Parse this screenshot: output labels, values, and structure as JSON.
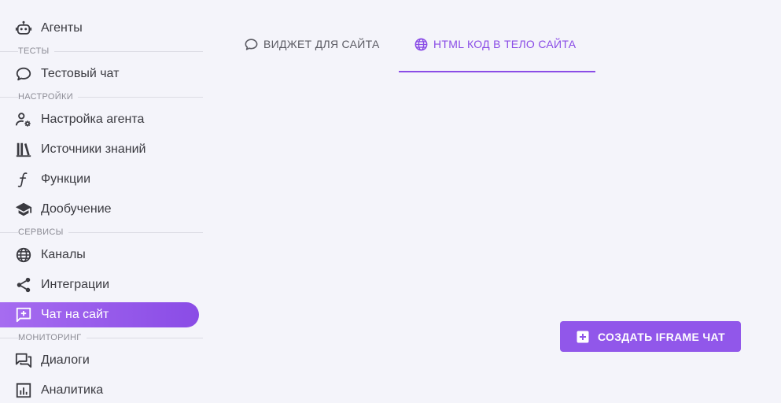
{
  "sidebar": {
    "items": [
      {
        "label": "Агенты"
      },
      {
        "label": "Тестовый чат"
      },
      {
        "label": "Настройка агента"
      },
      {
        "label": "Источники знаний"
      },
      {
        "label": "Функции"
      },
      {
        "label": "Дообучение"
      },
      {
        "label": "Каналы"
      },
      {
        "label": "Интеграции"
      },
      {
        "label": "Чат на сайт"
      },
      {
        "label": "Диалоги"
      },
      {
        "label": "Аналитика"
      }
    ],
    "sections": [
      {
        "label": "ТЕСТЫ"
      },
      {
        "label": "НАСТРОЙКИ"
      },
      {
        "label": "СЕРВИСЫ"
      },
      {
        "label": "МОНИТОРИНГ"
      }
    ]
  },
  "tabs": [
    {
      "label": "ВИДЖЕТ ДЛЯ САЙТА",
      "icon": "chat-bubble-icon"
    },
    {
      "label": "HTML КОД В ТЕЛО САЙТА",
      "icon": "globe-icon"
    }
  ],
  "actions": {
    "create_label": "СОЗДАТЬ IFRAME ЧАТ"
  },
  "colors": {
    "accent": "#8a4ce6",
    "background": "#f4f4fa"
  }
}
